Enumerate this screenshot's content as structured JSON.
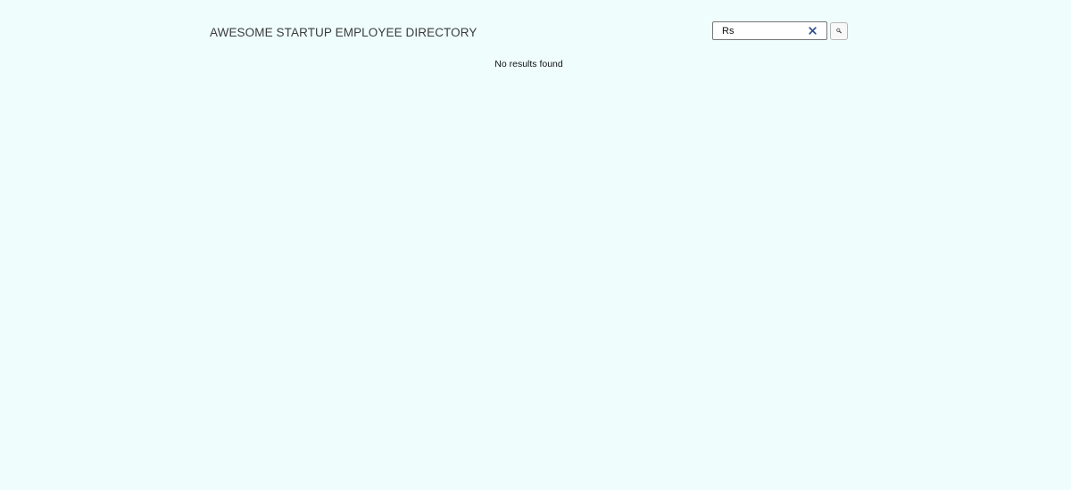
{
  "header": {
    "title": "AWESOME STARTUP EMPLOYEE DIRECTORY"
  },
  "search": {
    "value": "Rs",
    "clear_icon": "close-icon",
    "submit_icon": "magnifier-icon",
    "clear_color": "#2a4a8c"
  },
  "results": {
    "empty_message": "No results found"
  },
  "theme": {
    "background": "#effefd"
  }
}
